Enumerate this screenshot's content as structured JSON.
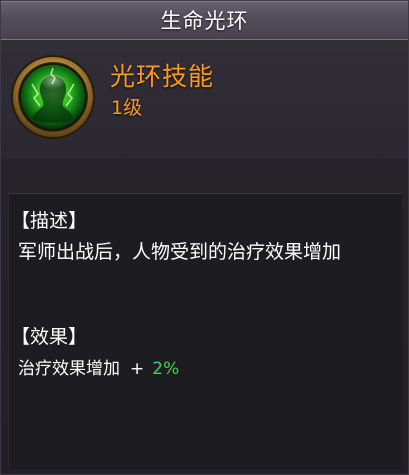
{
  "window": {
    "title": "生命光环"
  },
  "skill": {
    "icon": "green-spirit-aura-icon",
    "name": "光环技能",
    "level": "1级"
  },
  "description": {
    "header": "【描述】",
    "text": "军师出战后，人物受到的治疗效果增加"
  },
  "effect": {
    "header": "【效果】",
    "label": "治疗效果增加",
    "operator": "+",
    "value": "2%"
  },
  "colors": {
    "title_bar": "#534d5b",
    "skill_text": "#ff9a1e",
    "effect_value": "#3fd35a",
    "content_bg": "#1d1c20"
  }
}
